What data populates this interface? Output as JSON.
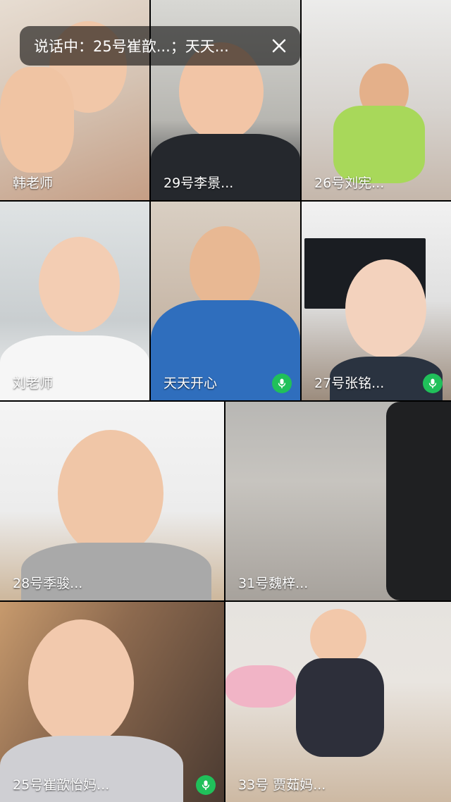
{
  "call_banner": {
    "text": "说话中：25号崔歆...；天天...",
    "close_icon": "close-icon"
  },
  "participants": [
    {
      "name": "韩老师",
      "speaking": false
    },
    {
      "name": "29号李景...",
      "speaking": false
    },
    {
      "name": "26号刘宪...",
      "speaking": false
    },
    {
      "name": "刘老师",
      "speaking": false
    },
    {
      "name": "天天开心",
      "speaking": true
    },
    {
      "name": "27号张铭...",
      "speaking": true
    },
    {
      "name": "28号季骏...",
      "speaking": false
    },
    {
      "name": "31号魏梓...",
      "speaking": false
    },
    {
      "name": "25号崔歆怡妈...",
      "speaking": true
    },
    {
      "name": "33号 贾茹妈...",
      "speaking": false
    }
  ],
  "icons": {
    "speaking": "microphone-icon"
  },
  "colors": {
    "speaking_indicator": "#20c05a"
  }
}
